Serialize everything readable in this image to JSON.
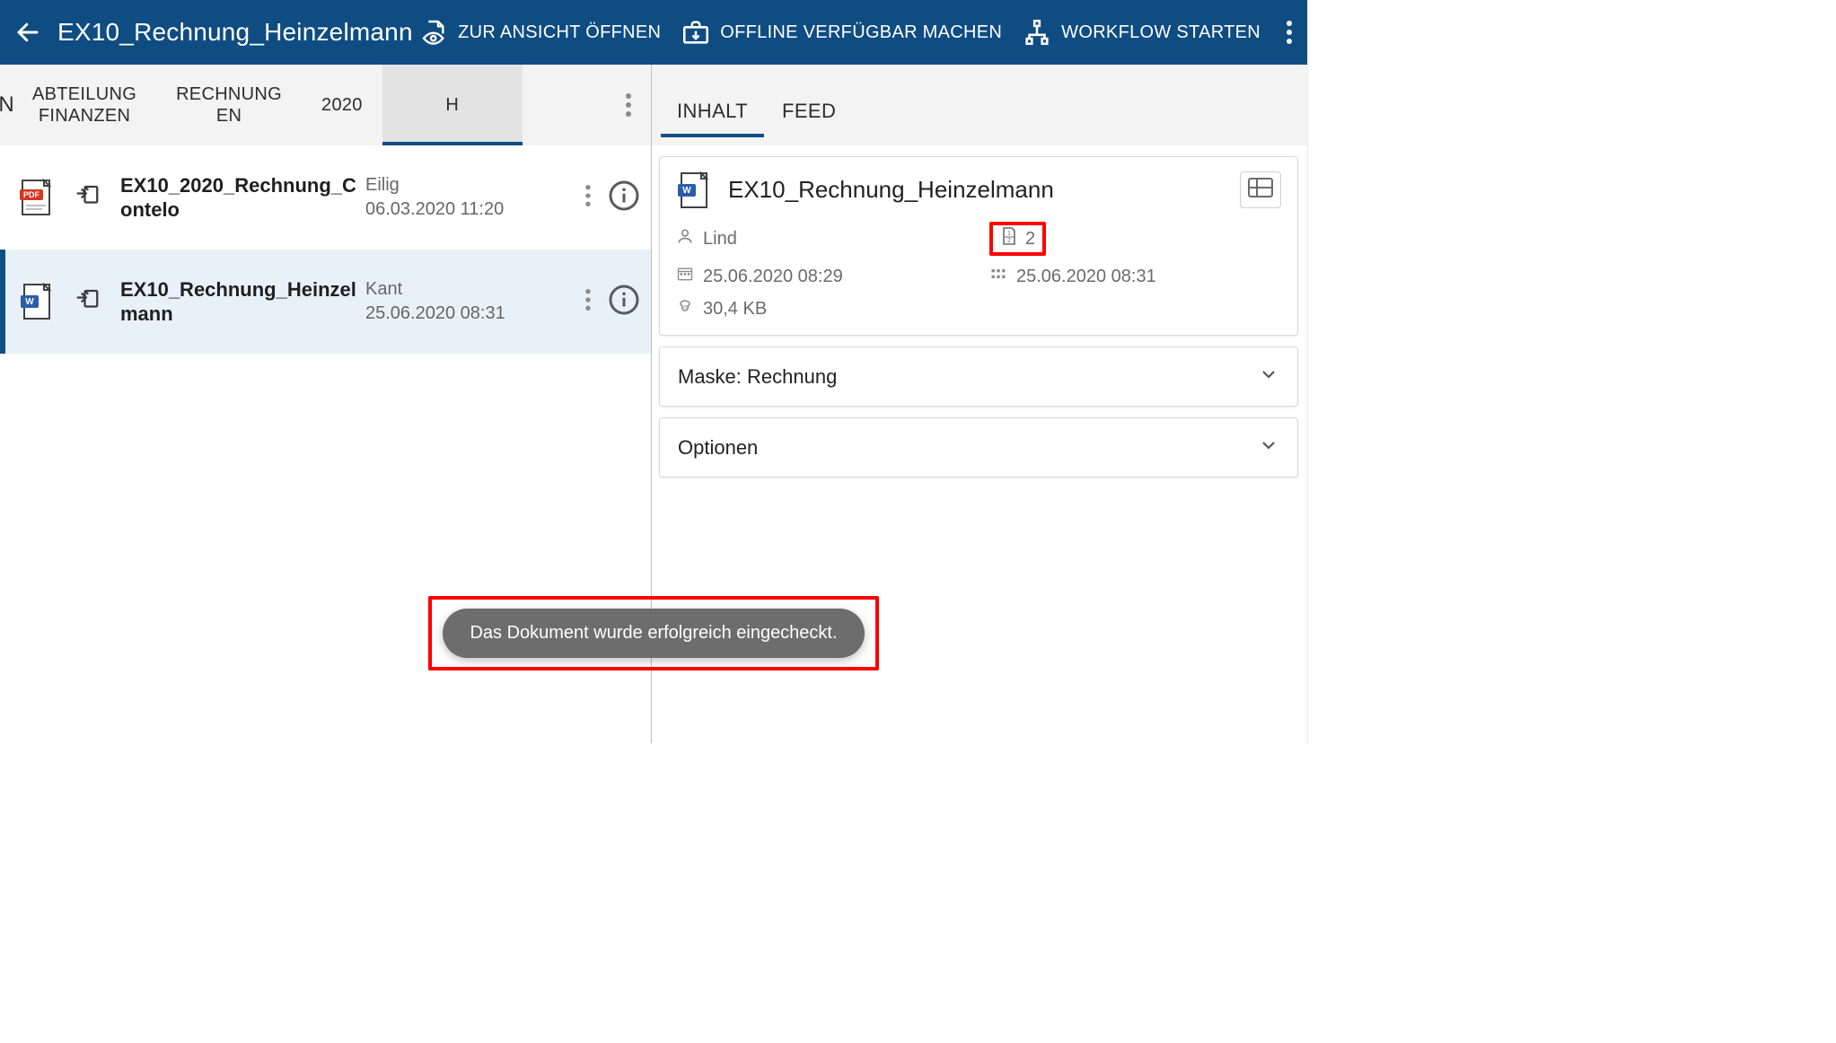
{
  "topbar": {
    "title": "EX10_Rechnung_Heinzelmann",
    "actions": {
      "open_view": "ZUR ANSICHT ÖFFNEN",
      "offline": "OFFLINE VERFÜGBAR MACHEN",
      "workflow": "WORKFLOW STARTEN"
    }
  },
  "breadcrumb": {
    "left_edge": "N",
    "items": [
      {
        "label": "ABTEILUNG\nFINANZEN",
        "multiline": true
      },
      {
        "label": "RECHNUNG\nEN",
        "multiline": true
      },
      {
        "label": "2020",
        "multiline": false
      },
      {
        "label": "H",
        "multiline": false,
        "active": true
      }
    ]
  },
  "rows": [
    {
      "kind": "pdf",
      "name": "EX10_2020_Rechnung_Contelo",
      "user": "Eilig",
      "date": "06.03.2020 11:20",
      "selected": false
    },
    {
      "kind": "word",
      "name": "EX10_Rechnung_Heinzelmann",
      "user": "Kant",
      "date": "25.06.2020 08:31",
      "selected": true
    }
  ],
  "rightTabs": {
    "inhalt": "INHALT",
    "feed": "FEED",
    "active": "inhalt"
  },
  "details": {
    "title": "EX10_Rechnung_Heinzelmann",
    "user": "Lind",
    "version": "2",
    "created": "25.06.2020 08:29",
    "modified": "25.06.2020 08:31",
    "size": "30,4 KB"
  },
  "accordions": {
    "mask": "Maske: Rechnung",
    "options": "Optionen"
  },
  "toast": "Das Dokument wurde erfolgreich eingecheckt."
}
